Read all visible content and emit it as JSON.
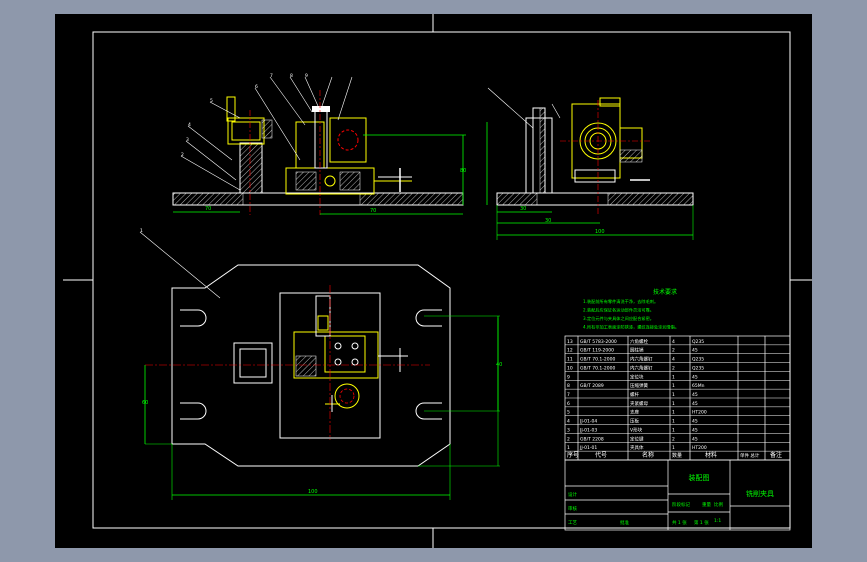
{
  "drawing": {
    "tech_requirements_title": "技术要求",
    "tech_requirements": [
      "1.装配前所有零件清洗干净，去除毛刺。",
      "2.装配后应保证各运动部件灵活可靠。",
      "3.定位元件与夹具体之间应配合紧密。",
      "4.所有非加工表面涂防锈漆，螺纹连接处涂润滑脂。"
    ],
    "bom_rows": [
      {
        "no": "13",
        "code": "GB/T 5783-2000",
        "name": "六角螺栓",
        "qty": "4",
        "mat": "Q235"
      },
      {
        "no": "12",
        "code": "GB/T 119-2000",
        "name": "圆柱销",
        "qty": "2",
        "mat": "45"
      },
      {
        "no": "11",
        "code": "GB/T 70.1-2000",
        "name": "内六角螺钉",
        "qty": "4",
        "mat": "Q235"
      },
      {
        "no": "10",
        "code": "GB/T 70.1-2000",
        "name": "内六角螺钉",
        "qty": "2",
        "mat": "Q235"
      },
      {
        "no": "9",
        "code": "",
        "name": "定位块",
        "qty": "1",
        "mat": "45"
      },
      {
        "no": "8",
        "code": "GB/T 2089",
        "name": "压缩弹簧",
        "qty": "1",
        "mat": "65Mn"
      },
      {
        "no": "7",
        "code": "",
        "name": "螺杆",
        "qty": "1",
        "mat": "45"
      },
      {
        "no": "6",
        "code": "",
        "name": "夹紧螺母",
        "qty": "1",
        "mat": "45"
      },
      {
        "no": "5",
        "code": "",
        "name": "支座",
        "qty": "1",
        "mat": "HT200"
      },
      {
        "no": "4",
        "code": "JJ-01-04",
        "name": "压板",
        "qty": "1",
        "mat": "45"
      },
      {
        "no": "3",
        "code": "JJ-01-03",
        "name": "V形块",
        "qty": "1",
        "mat": "45"
      },
      {
        "no": "2",
        "code": "GB/T 2208",
        "name": "定位键",
        "qty": "2",
        "mat": "45"
      },
      {
        "no": "1",
        "code": "JJ-01-01",
        "name": "夹具体",
        "qty": "1",
        "mat": "HT200"
      }
    ],
    "bom_header": {
      "no": "序号",
      "code": "代号",
      "name": "名称",
      "qty": "数量",
      "mat": "材料",
      "weight": "单件 总计",
      "note": "备注"
    },
    "title_block": {
      "company": "装配图",
      "drawing_name": "铣削夹具",
      "scale_label": "比例",
      "scale": "1:1",
      "sheet_label": "共 1 张",
      "sheet_no": "第 1 张",
      "designer": "设计",
      "checker": "审核",
      "process": "工艺",
      "approve": "批准",
      "stage": "阶段标记",
      "weight": "重量"
    },
    "dimensions": {
      "front_width": "70",
      "front_height": "80",
      "side_width": "30",
      "side_total": "100",
      "plan_width": "100",
      "plan_height": "60",
      "plan_right": "40"
    },
    "balloons": [
      "1",
      "2",
      "3",
      "4",
      "5",
      "6",
      "7",
      "8",
      "9"
    ],
    "colors": {
      "paper": "#000000",
      "frame": "#ffffff",
      "part_yellow": "#ffff00",
      "dim_green": "#00ff00",
      "center_red": "#ff0000",
      "hidden_magenta": "#ff00ff",
      "table_white": "#ffffff",
      "hatch": "#ffffff"
    }
  }
}
